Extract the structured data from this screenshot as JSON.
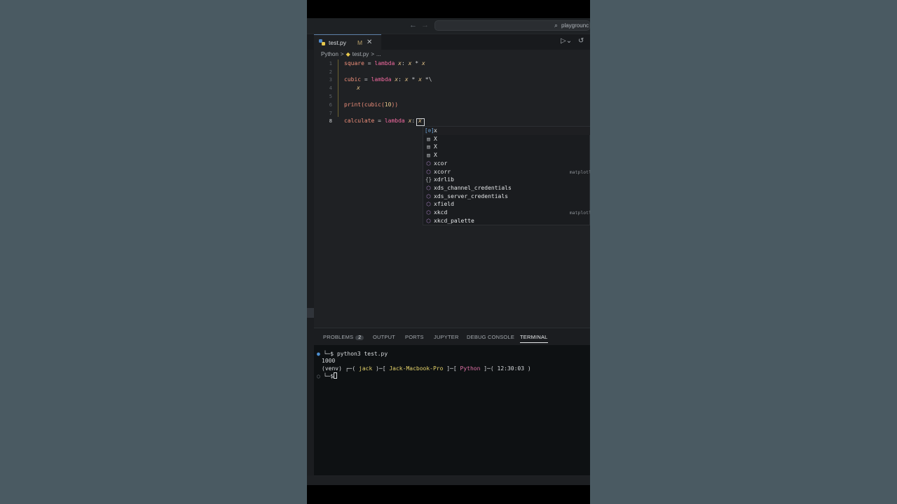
{
  "titlebar": {
    "back_icon": "arrow-left-icon",
    "forward_icon": "arrow-right-icon",
    "search_text": "playgrounc",
    "search_icon": "search-icon"
  },
  "tab": {
    "filename": "test.py",
    "modified": "M",
    "close": "✕"
  },
  "breadcrumb": {
    "folder": "Python",
    "sep": ">",
    "file": "test.py",
    "sep2": ">",
    "more": "..."
  },
  "code_lines": [
    {
      "n": "1",
      "text": "square = lambda x: x * x"
    },
    {
      "n": "2",
      "text": ""
    },
    {
      "n": "3",
      "text": "cubic = lambda x: x * x *\\"
    },
    {
      "n": "4",
      "text": "x"
    },
    {
      "n": "5",
      "text": ""
    },
    {
      "n": "6",
      "text": "print(cubic(10))"
    },
    {
      "n": "7",
      "text": ""
    },
    {
      "n": "8",
      "text": "calculate = lambda x: x"
    }
  ],
  "suggestions": [
    {
      "icon": "variable-icon",
      "glyph": "[⊘]",
      "label": "x",
      "detail": ""
    },
    {
      "icon": "field-icon",
      "glyph": "▤",
      "label": "X",
      "detail": ""
    },
    {
      "icon": "field-icon",
      "glyph": "▤",
      "label": "X",
      "detail": ""
    },
    {
      "icon": "field-icon",
      "glyph": "▤",
      "label": "X",
      "detail": ""
    },
    {
      "icon": "module-icon",
      "glyph": "⬡",
      "label": "xcor",
      "detail": ""
    },
    {
      "icon": "module-icon",
      "glyph": "⬡",
      "label": "xcorr",
      "detail": "matplotl"
    },
    {
      "icon": "namespace-icon",
      "glyph": "{}",
      "label": "xdrlib",
      "detail": ""
    },
    {
      "icon": "module-icon",
      "glyph": "⬡",
      "label": "xds_channel_credentials",
      "detail": ""
    },
    {
      "icon": "module-icon",
      "glyph": "⬡",
      "label": "xds_server_credentials",
      "detail": ""
    },
    {
      "icon": "module-icon",
      "glyph": "⬡",
      "label": "xfield",
      "detail": ""
    },
    {
      "icon": "module-icon",
      "glyph": "⬡",
      "label": "xkcd",
      "detail": "matplotl"
    },
    {
      "icon": "module-icon",
      "glyph": "⬡",
      "label": "xkcd_palette",
      "detail": ""
    }
  ],
  "panel": {
    "tabs": [
      "PROBLEMS",
      "OUTPUT",
      "PORTS",
      "JUPYTER",
      "DEBUG CONSOLE",
      "TERMINAL"
    ],
    "problems_count": "2",
    "active_tab": "TERMINAL"
  },
  "terminal": {
    "cmd_prompt": "└─$",
    "command": "python3 test.py",
    "output": "1000",
    "venv": "(venv)",
    "user": "jack",
    "host": "Jack-Macbook-Pro",
    "dir": "Python",
    "time": "12:30:03",
    "prompt2": "└─$"
  },
  "colors": {
    "background": "#4a5a62",
    "editor_bg": "#1f2124",
    "terminal_bg": "#0e1113",
    "keyword": "#f36aa0",
    "identifier": "#f08f7a",
    "param": "#e8c68a",
    "accent": "#5c7ea6"
  }
}
